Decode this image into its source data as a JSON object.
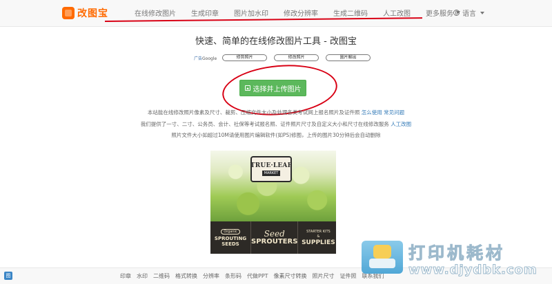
{
  "navbar": {
    "brand": "改图宝",
    "items": [
      "在线修改图片",
      "生成印章",
      "图片加水印",
      "修改分辨率",
      "生成二维码",
      "人工改图",
      "更多服务"
    ],
    "language": "语言"
  },
  "main": {
    "title": "快速、简单的在线修改图片工具 - 改图宝",
    "ad_label": "广告",
    "ad_label_google": "Google",
    "ad_pills": [
      "修剪照片",
      "修改照片",
      "圖片輸出"
    ],
    "upload_button": "选择并上传图片",
    "info_line1": "本站能在线修改照片像素及尺寸、裁剪、压缩文件大小及处理各类考试网上报名照片及证件照",
    "info_link1": "怎么使用",
    "info_link2": "常见问题",
    "info_line2": "我们提供了一寸、二寸、公务员、会计、社保等考试报名照、证件照片尺寸及自定义大小和尺寸在线修改服务",
    "info_link3": "人工改图",
    "info_line3": "照片文件大小如超过10M请使用图片编辑软件(如PS)修图，上传的图片30分钟后会自动删除"
  },
  "ad": {
    "logo_line1": "TRUE·LEAF",
    "logo_line2": "MARKET",
    "organic": "Organic",
    "col1": [
      "SPROUTING",
      "SEEDS"
    ],
    "col2_script": "Seed",
    "col2": "SPROUTERS",
    "col3_small": "STARTER KITS",
    "col3_and": "&",
    "col3": "SUPPLIES"
  },
  "watermark": {
    "text": "打印机耗材",
    "url": "www.djydbk.com"
  },
  "footer": {
    "icon_char": "图",
    "links": [
      "印章",
      "水印",
      "二维码",
      "格式转换",
      "分辨率",
      "条形码",
      "代做PPT",
      "像素尺寸转换",
      "照片尺寸",
      "证件照",
      "联系我们"
    ]
  },
  "colors": {
    "accent_orange": "#ff6a00",
    "annotation_red": "#d80014",
    "button_green": "#5cb85c",
    "link_blue": "#337ab7"
  }
}
